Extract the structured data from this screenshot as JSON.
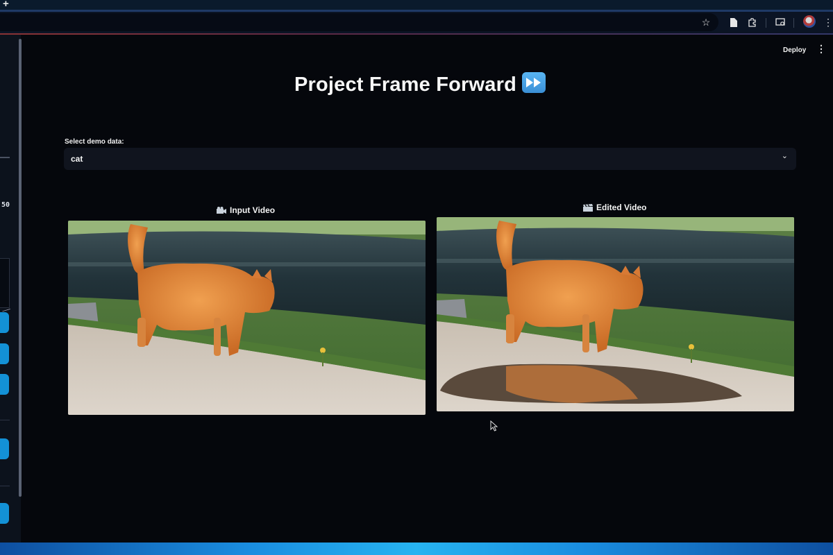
{
  "browser": {
    "new_tab_symbol": "+",
    "toolbar_icons": [
      "star-icon",
      "document-icon",
      "extensions-icon",
      "cast-icon",
      "profile-avatar",
      "menu-dots-icon"
    ]
  },
  "sidebar": {
    "value": "50"
  },
  "header": {
    "deploy_label": "Deploy",
    "menu_symbol": "⋮"
  },
  "page": {
    "title": "Project Frame Forward",
    "title_emoji": "fast-forward-icon"
  },
  "select": {
    "label": "Select demo data:",
    "value": "cat",
    "chevron": "⌄"
  },
  "videos": {
    "input_label": "Input Video",
    "input_icon": "film-projector-icon",
    "edited_label": "Edited Video",
    "edited_icon": "clapper-board-icon"
  },
  "colors": {
    "background": "#05070c",
    "select_bg": "#10141e",
    "sidebar_button": "#1391d6"
  }
}
